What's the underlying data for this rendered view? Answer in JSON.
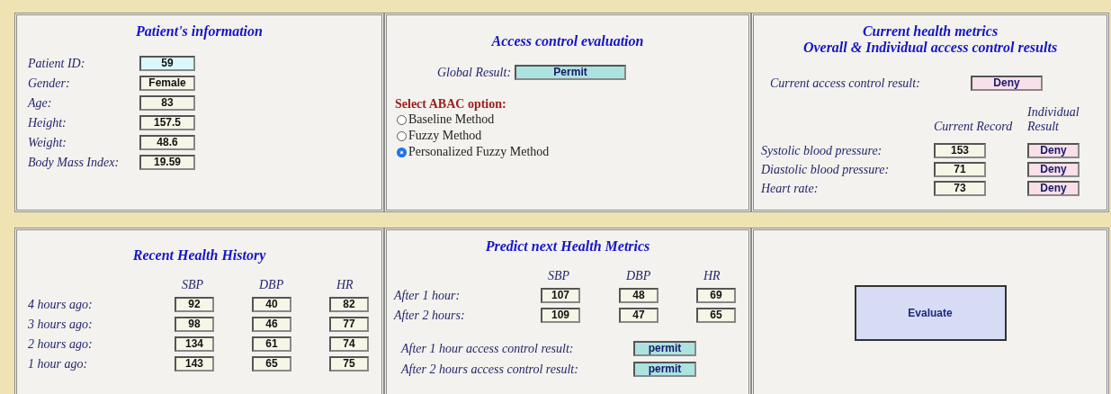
{
  "patient_info": {
    "title": "Patient's information",
    "fields": [
      {
        "label": "Patient ID:",
        "value": "59",
        "kind": "id"
      },
      {
        "label": "Gender:",
        "value": "Female",
        "kind": "value"
      },
      {
        "label": "Age:",
        "value": "83",
        "kind": "value"
      },
      {
        "label": "Height:",
        "value": "157.5",
        "kind": "value"
      },
      {
        "label": "Weight:",
        "value": "48.6",
        "kind": "value"
      },
      {
        "label": "Body Mass Index:",
        "value": "19.59",
        "kind": "value"
      }
    ]
  },
  "access_evaluation": {
    "title": "Access control evaluation",
    "global_result": {
      "label": "Global Result:",
      "value": "Permit",
      "kind": "permit"
    },
    "abac_heading": "Select ABAC option:",
    "options": [
      {
        "label": "Baseline Method",
        "selected": false
      },
      {
        "label": "Fuzzy Method",
        "selected": false
      },
      {
        "label": "Personalized Fuzzy Method",
        "selected": true
      }
    ]
  },
  "current_metrics": {
    "title_lines": [
      "Current health metrics",
      "Overall & Individual access control results"
    ],
    "current_result": {
      "label": "Current access control result:",
      "value": "Deny",
      "kind": "deny"
    },
    "columns": [
      "Current Record",
      "Individual Result"
    ],
    "rows": [
      {
        "label": "Systolic blood pressure:",
        "record": "153",
        "result": {
          "value": "Deny",
          "kind": "deny"
        }
      },
      {
        "label": "Diastolic blood pressure:",
        "record": "71",
        "result": {
          "value": "Deny",
          "kind": "deny"
        }
      },
      {
        "label": "Heart rate:",
        "record": "73",
        "result": {
          "value": "Deny",
          "kind": "deny"
        }
      }
    ]
  },
  "history": {
    "title": "Recent Health History",
    "columns": [
      "SBP",
      "DBP",
      "HR"
    ],
    "rows": [
      {
        "label": "4 hours ago:",
        "values": [
          "92",
          "40",
          "82"
        ]
      },
      {
        "label": "3 hours ago:",
        "values": [
          "98",
          "46",
          "77"
        ]
      },
      {
        "label": "2 hours ago:",
        "values": [
          "134",
          "61",
          "74"
        ]
      },
      {
        "label": "1 hour ago:",
        "values": [
          "143",
          "65",
          "75"
        ]
      }
    ]
  },
  "prediction": {
    "title": "Predict next Health Metrics",
    "columns": [
      "SBP",
      "DBP",
      "HR"
    ],
    "rows": [
      {
        "label": "After 1 hour:",
        "values": [
          "107",
          "48",
          "69"
        ]
      },
      {
        "label": "After 2 hours:",
        "values": [
          "109",
          "47",
          "65"
        ]
      }
    ],
    "results": [
      {
        "label": "After 1 hour access control result:",
        "value": "permit",
        "kind": "permit"
      },
      {
        "label": "After 2 hours access control result:",
        "value": "permit",
        "kind": "permit"
      }
    ]
  },
  "evaluate_button": {
    "label": "Evaluate"
  }
}
